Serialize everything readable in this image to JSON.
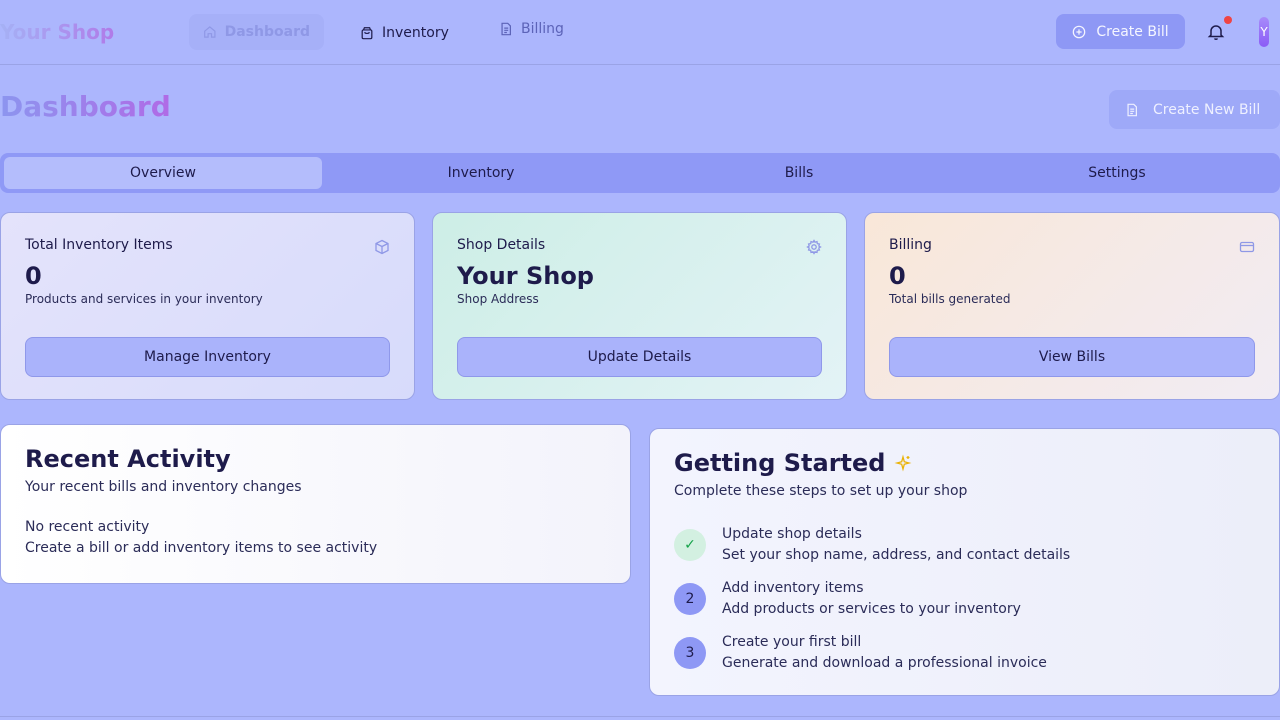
{
  "app": {
    "brand": "Your Shop"
  },
  "nav": {
    "items": [
      {
        "label": "Dashboard",
        "icon": "home-icon",
        "active": true
      },
      {
        "label": "Inventory",
        "icon": "shopping-bag-icon",
        "active": false
      },
      {
        "label": "Billing",
        "icon": "document-icon",
        "active": false
      }
    ],
    "create_bill_label": "Create Bill",
    "has_notification": true,
    "avatar_initial": "Y"
  },
  "page": {
    "title": "Dashboard",
    "create_new_bill_label": "Create New Bill"
  },
  "tabs": [
    {
      "label": "Overview",
      "active": true
    },
    {
      "label": "Inventory",
      "active": false
    },
    {
      "label": "Bills",
      "active": false
    },
    {
      "label": "Settings",
      "active": false
    }
  ],
  "cards": [
    {
      "title": "Total Inventory Items",
      "icon": "box-icon",
      "value": "0",
      "subtitle": "Products and services in your inventory",
      "button": "Manage Inventory"
    },
    {
      "title": "Shop Details",
      "icon": "gear-icon",
      "value": "Your Shop",
      "subtitle": "Shop Address",
      "button": "Update Details"
    },
    {
      "title": "Billing",
      "icon": "credit-card-icon",
      "value": "0",
      "subtitle": "Total bills generated",
      "button": "View Bills"
    }
  ],
  "recent_activity": {
    "title": "Recent Activity",
    "subtitle": "Your recent bills and inventory changes",
    "empty_title": "No recent activity",
    "empty_hint": "Create a bill or add inventory items to see activity"
  },
  "getting_started": {
    "title": "Getting Started",
    "subtitle": "Complete these steps to set up your shop",
    "steps": [
      {
        "badge": "✓",
        "done": true,
        "title": "Update shop details",
        "desc": "Set your shop name, address, and contact details"
      },
      {
        "badge": "2",
        "done": false,
        "title": "Add inventory items",
        "desc": "Add products or services to your inventory"
      },
      {
        "badge": "3",
        "done": false,
        "title": "Create your first bill",
        "desc": "Generate and download a professional invoice"
      }
    ]
  },
  "colors": {
    "background": "#acb6fd",
    "accent": "#8e98f5",
    "success": "#16a34a",
    "notification": "#ef4444"
  }
}
